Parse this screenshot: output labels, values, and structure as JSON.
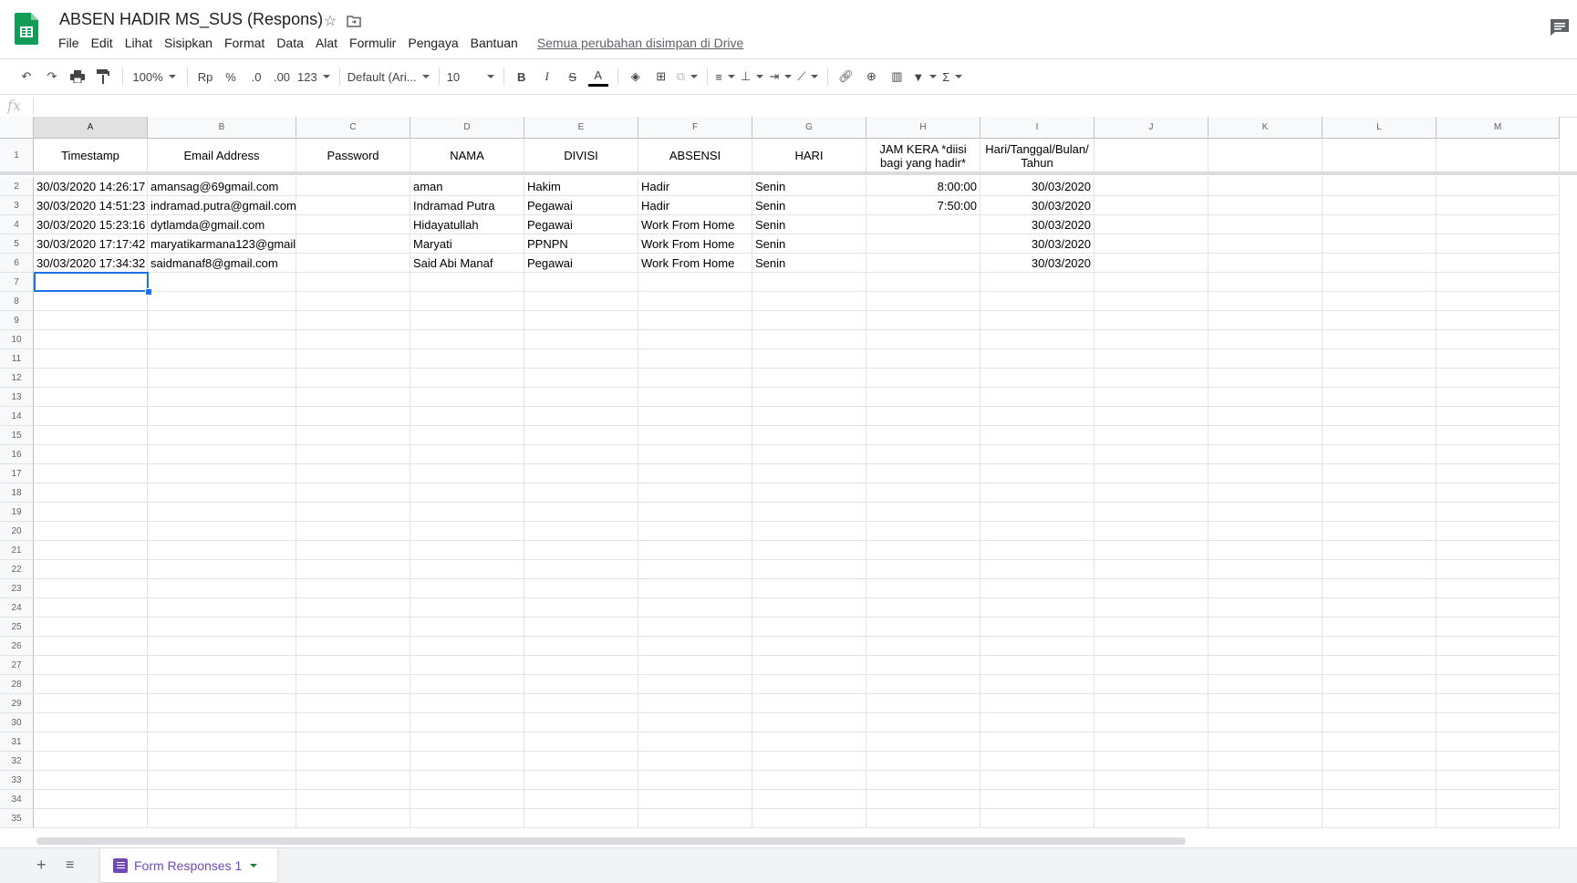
{
  "app": {
    "title": "ABSEN HADIR MS_SUS (Respons)",
    "save_status": "Semua perubahan disimpan di Drive",
    "menu": [
      "File",
      "Edit",
      "Lihat",
      "Sisipkan",
      "Format",
      "Data",
      "Alat",
      "Formulir",
      "Pengaya",
      "Bantuan"
    ]
  },
  "toolbar": {
    "zoom": "100%",
    "currency": "Rp",
    "percent": "%",
    "dec_decrease": ".0",
    "dec_increase": ".00",
    "more_formats": "123",
    "font": "Default (Ari...",
    "font_size": "10"
  },
  "formula_bar": {
    "fx": "fx",
    "value": ""
  },
  "sheet": {
    "columns": [
      "A",
      "B",
      "C",
      "D",
      "E",
      "F",
      "G",
      "H",
      "I",
      "J",
      "K",
      "L",
      "M"
    ],
    "headers": [
      "Timestamp",
      "Email Address",
      "Password",
      "NAMA",
      "DIVISI",
      "ABSENSI",
      "HARI",
      "JAM KERA   *diisi bagi yang hadir*",
      "Hari/Tanggal/Bulan/ Tahun",
      "",
      "",
      "",
      ""
    ],
    "rows": [
      [
        "30/03/2020 14:26:17",
        "amansag@69gmail.com",
        "",
        "aman",
        "Hakim",
        "Hadir",
        "Senin",
        "8:00:00",
        "30/03/2020",
        "",
        "",
        "",
        ""
      ],
      [
        "30/03/2020 14:51:23",
        "indramad.putra@gmail.com",
        "",
        "Indramad Putra",
        "Pegawai",
        "Hadir",
        "Senin",
        "7:50:00",
        "30/03/2020",
        "",
        "",
        "",
        ""
      ],
      [
        "30/03/2020 15:23:16",
        "dytlamda@gmail.com",
        "",
        "Hidayatullah",
        "Pegawai",
        "Work From Home",
        "Senin",
        "",
        "30/03/2020",
        "",
        "",
        "",
        ""
      ],
      [
        "30/03/2020 17:17:42",
        "maryatikarmana123@gmail",
        "",
        "Maryati",
        "PPNPN",
        "Work From Home",
        "Senin",
        "",
        "30/03/2020",
        "",
        "",
        "",
        ""
      ],
      [
        "30/03/2020 17:34:32",
        "saidmanaf8@gmail.com",
        "",
        "Said Abi Manaf",
        "Pegawai",
        "Work From Home",
        "Senin",
        "",
        "30/03/2020",
        "",
        "",
        "",
        ""
      ]
    ],
    "row_numbers": [
      "1",
      "2",
      "3",
      "4",
      "5",
      "6",
      "7",
      "8",
      "9",
      "10",
      "11",
      "12",
      "13",
      "14",
      "15",
      "16",
      "17",
      "18",
      "19",
      "20",
      "21",
      "22",
      "23",
      "24",
      "25",
      "26",
      "27",
      "28",
      "29",
      "30",
      "31",
      "32",
      "33",
      "34",
      "35"
    ]
  },
  "sheet_tab": {
    "label": "Form Responses 1"
  },
  "colors": {
    "accent": "#1a73e8",
    "sheets_green": "#188038",
    "forms_purple": "#7248b9"
  }
}
